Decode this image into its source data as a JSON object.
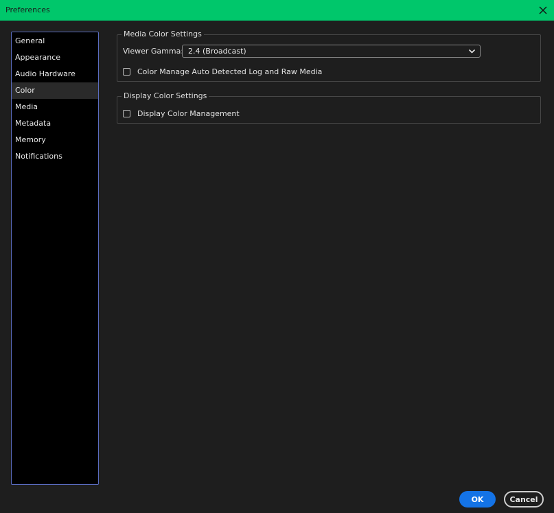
{
  "window": {
    "title": "Preferences"
  },
  "sidebar": {
    "selected": "Color",
    "items": [
      {
        "label": "General"
      },
      {
        "label": "Appearance"
      },
      {
        "label": "Audio Hardware"
      },
      {
        "label": "Color"
      },
      {
        "label": "Media"
      },
      {
        "label": "Metadata"
      },
      {
        "label": "Memory"
      },
      {
        "label": "Notifications"
      }
    ]
  },
  "media_color": {
    "legend": "Media Color Settings",
    "gamma_label": "Viewer Gamma:",
    "gamma_value": "2.4 (Broadcast)",
    "auto_log_label": "Color Manage Auto Detected Log and Raw Media",
    "auto_log_checked": false
  },
  "display_color": {
    "legend": "Display Color Settings",
    "management_label": "Display Color Management",
    "management_checked": false
  },
  "buttons": {
    "ok": "OK",
    "cancel": "Cancel"
  },
  "colors": {
    "titlebar": "#00c76b",
    "accent": "#1473e6",
    "sidebar_border": "#5a6cc0"
  },
  "icons": {
    "close": "close-icon",
    "dropdown": "chevron-down-icon"
  }
}
